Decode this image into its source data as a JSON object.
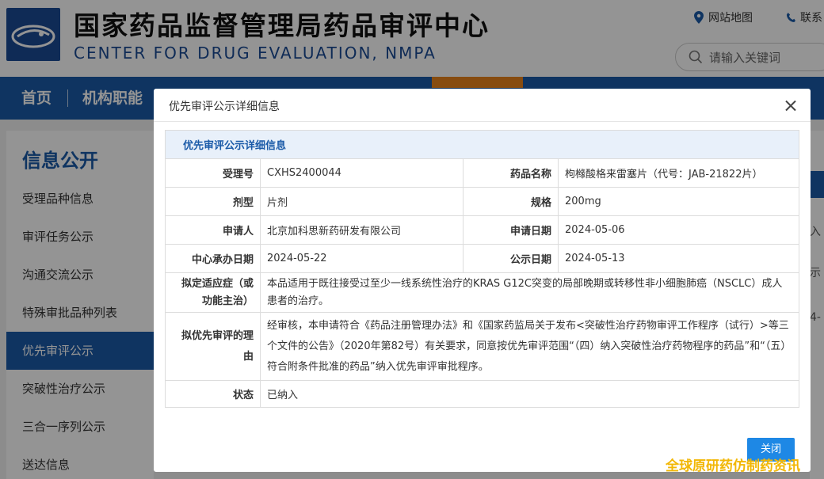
{
  "header": {
    "title": "国家药品监督管理局药品审评中心",
    "subtitle": "CENTER FOR DRUG EVALUATION, NMPA",
    "sitemap_label": "网站地图",
    "contact_label": "联系",
    "search_placeholder": "请输入关键词"
  },
  "nav": {
    "items": [
      {
        "label": "首页"
      },
      {
        "label": "机构职能"
      }
    ],
    "active_color": "#e8831c"
  },
  "sidebar": {
    "title": "信息公开",
    "items": [
      {
        "label": "受理品种信息"
      },
      {
        "label": "审评任务公示"
      },
      {
        "label": "沟通交流公示"
      },
      {
        "label": "特殊审批品种列表"
      },
      {
        "label": "优先审评公示"
      },
      {
        "label": "突破性治疗公示"
      },
      {
        "label": "三合一序列公示"
      },
      {
        "label": "送达信息"
      }
    ]
  },
  "right_fragments": [
    "入",
    "示",
    "4-"
  ],
  "modal": {
    "title": "优先审评公示详细信息",
    "table_caption": "优先审评公示详细信息",
    "fields": {
      "accept_no_label": "受理号",
      "accept_no": "CXHS2400044",
      "drug_name_label": "药品名称",
      "drug_name": "枸橼酸格来雷塞片（代号：JAB-21822片）",
      "dosage_form_label": "剂型",
      "dosage_form": "片剂",
      "spec_label": "规格",
      "spec": "200mg",
      "applicant_label": "申请人",
      "applicant": "北京加科思新药研发有限公司",
      "apply_date_label": "申请日期",
      "apply_date": "2024-05-06",
      "center_date_label": "中心承办日期",
      "center_date": "2024-05-22",
      "publish_date_label": "公示日期",
      "publish_date": "2024-05-13",
      "indication_label": "拟定适应症（或功能主治）",
      "indication": "本品适用于既往接受过至少一线系统性治疗的KRAS G12C突变的局部晚期或转移性非小细胞肺癌（NSCLC）成人患者的治疗。",
      "reason_label": "拟优先审评的理由",
      "reason": "经审核，本申请符合《药品注册管理办法》和《国家药监局关于发布<突破性治疗药物审评工作程序（试行）>等三个文件的公告》（2020年第82号）有关要求，同意按优先审评范围“（四）纳入突破性治疗药物程序的药品”和“（五）符合附条件批准的药品”纳入优先审评审批程序。",
      "status_label": "状态",
      "status": "已纳入"
    },
    "close_button": "关闭"
  },
  "watermark": "全球原研药仿制药资讯",
  "colors": {
    "brand_blue": "#1a5aa8",
    "button_blue": "#1e88e5",
    "watermark_yellow": "#f2b705"
  }
}
